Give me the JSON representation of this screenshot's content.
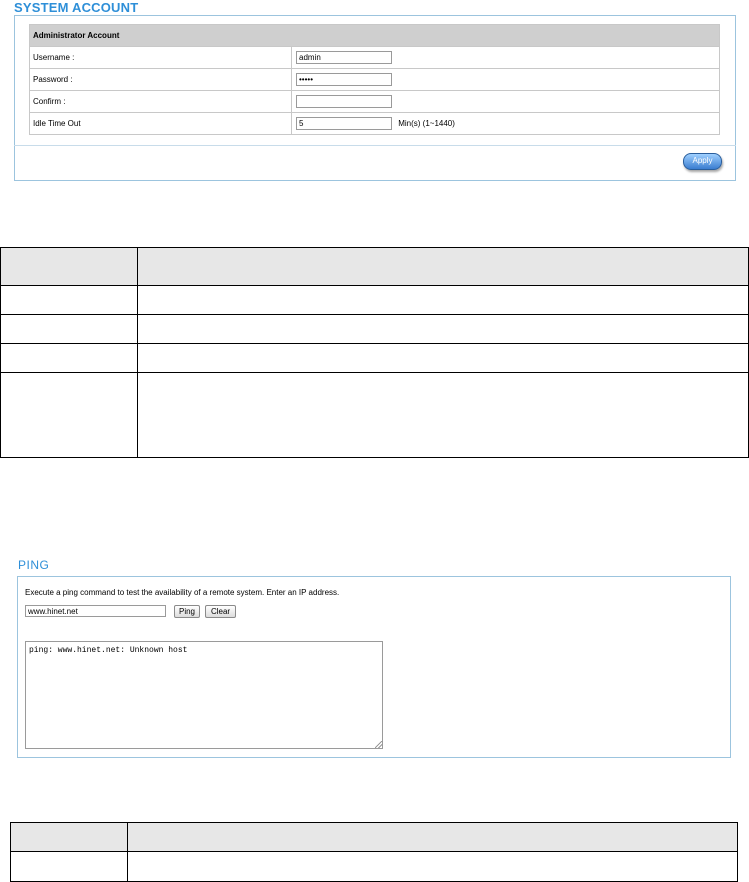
{
  "system_account": {
    "title": "SYSTEM ACCOUNT",
    "section_header": "Administrator Account",
    "rows": [
      {
        "label": "Username :",
        "value": "admin"
      },
      {
        "label": "Password :",
        "value": "•••••"
      },
      {
        "label": "Confirm :",
        "value": ""
      },
      {
        "label": "Idle Time Out",
        "value": "5",
        "unit": "Min(s)  (1~1440)"
      }
    ],
    "apply_label": "Apply"
  },
  "ping": {
    "title": "PING",
    "description": "Execute a ping command to test the availability of a remote system. Enter an IP address.",
    "host_value": "www.hinet.net",
    "ping_label": "Ping",
    "clear_label": "Clear",
    "output": "ping: www.hinet.net: Unknown host"
  },
  "colors": {
    "title_blue": "#2e8fd8",
    "panel_border": "#9cc4de",
    "header_gray": "#cfcfcf"
  }
}
